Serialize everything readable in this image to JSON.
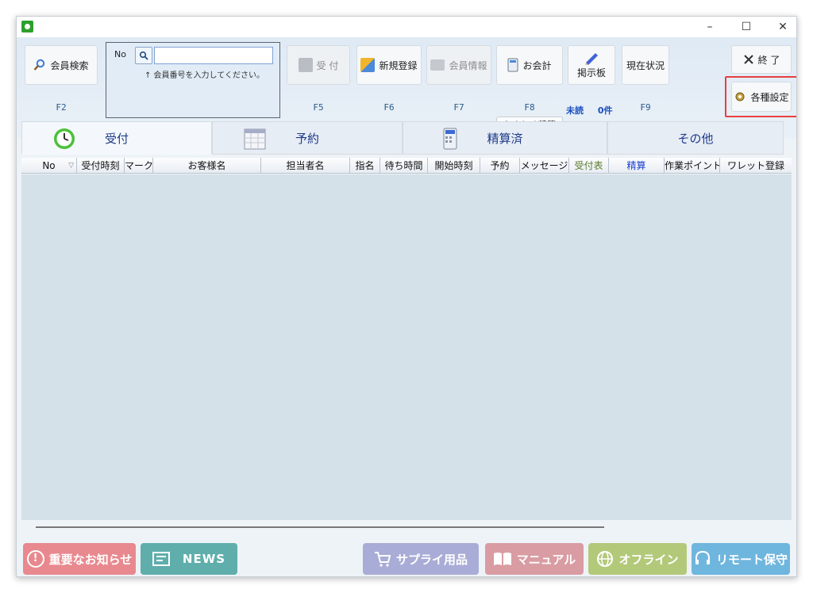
{
  "window": {
    "minimize": "–",
    "maximize": "☐",
    "close": "✕"
  },
  "toolbar": {
    "member_search": {
      "label": "会員検索",
      "key": "F2"
    },
    "search": {
      "no_label": "No",
      "value": "",
      "placeholder": "",
      "hint": "↑ 会員番号を入力してください。"
    },
    "reception": {
      "label": "受 付",
      "key": "F5"
    },
    "new_register": {
      "label": "新規登録",
      "key": "F6"
    },
    "member_info": {
      "label": "会員情報",
      "key": "F7"
    },
    "checkout": {
      "label": "お会計",
      "key": "F8"
    },
    "lump_sum": {
      "label": "おまとめ精算"
    },
    "board": {
      "label": "掲示板",
      "unread_label": "未読",
      "unread_count": "0件"
    },
    "status": {
      "label": "現在状況",
      "key": "F9"
    },
    "exit": {
      "label": "終 了"
    },
    "settings": {
      "label": "各種設定"
    }
  },
  "tabs": [
    {
      "label": "受付",
      "icon": "clock-icon"
    },
    {
      "label": "予約",
      "icon": "calendar-icon"
    },
    {
      "label": "精算済",
      "icon": "calculator-icon"
    },
    {
      "label": "その他",
      "icon": ""
    }
  ],
  "columns": [
    {
      "label": "No",
      "color": "#111111"
    },
    {
      "label": "受付時刻",
      "color": "#111111"
    },
    {
      "label": "マーク",
      "color": "#111111"
    },
    {
      "label": "お客様名",
      "color": "#111111"
    },
    {
      "label": "担当者名",
      "color": "#111111"
    },
    {
      "label": "指名",
      "color": "#111111"
    },
    {
      "label": "待ち時間",
      "color": "#111111"
    },
    {
      "label": "開始時刻",
      "color": "#111111"
    },
    {
      "label": "予約",
      "color": "#111111"
    },
    {
      "label": "メッセージ",
      "color": "#111111"
    },
    {
      "label": "受付表",
      "color": "#5b7a2a"
    },
    {
      "label": "精算",
      "color": "#1a3fd0"
    },
    {
      "label": "作業ポイント",
      "color": "#111111"
    },
    {
      "label": "ワレット登録",
      "color": "#111111"
    }
  ],
  "sort_indicator": "▽",
  "footer": {
    "important_notice": {
      "label": "重要なお知らせ",
      "color": "#e8898f"
    },
    "news": {
      "label": "NEWS",
      "color": "#5faeac"
    },
    "supply": {
      "label": "サプライ用品",
      "color": "#a9acd6"
    },
    "manual": {
      "label": "マニュアル",
      "color": "#d99ca3"
    },
    "offline": {
      "label": "オフライン",
      "color": "#b3c97a"
    },
    "remote": {
      "label": "リモート保守",
      "color": "#6fb6de"
    }
  },
  "colors": {
    "highlight": "#e64040",
    "grid_body": "#d4e1e9"
  }
}
